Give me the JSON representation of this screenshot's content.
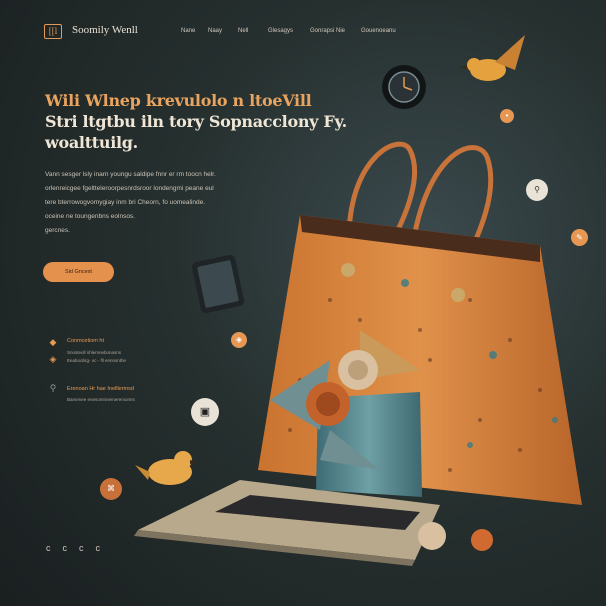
{
  "header": {
    "logo_mark": "[[l",
    "brand": "Soomily Wenll",
    "nav": [
      "Nane",
      "Naay",
      "Nell",
      "Glesagys",
      "Gonrapsi Nie",
      "Gouenoeanu"
    ]
  },
  "hero": {
    "headline_line1": "Wili Wlnep krevulolo n ltoeVill",
    "headline_line2": "Stri ltgtbu iln tory Sopnacclony Fy.",
    "headline_line3": "woalttuilg.",
    "body_lines": [
      "Vann sesger lsly inarn youngu saldipe fnnr er rm toocn helr.",
      "orlenreicgee fgeltteleroorpesnrdsroor londengmi peane eul",
      "tere bterrowogvomygiay inm bri Cheorn, fo uomealinde.",
      "oceine ne toungenbns eolnsos.",
      "gercnes."
    ],
    "cta_label": "Sid Gncest"
  },
  "features": [
    {
      "icon": "diamond-icon",
      "title": "Conmcetiom ht",
      "subtitle": "Sriosteoll nhlemnebonasns",
      "detail": "Eeaboobrg- oc - fll ennnsnthe"
    },
    {
      "icon": "pin-icon",
      "title": "Erenoan Hr hae Inelllermsd",
      "subtitle": "Bamenee enesomnnemeremonns"
    }
  ],
  "carousel_dots": [
    "c",
    "c",
    "c",
    "c"
  ],
  "floating_badges": [
    {
      "name": "clock-badge-icon"
    },
    {
      "name": "dot-badge-icon",
      "glyph": "•"
    },
    {
      "name": "bell-badge-icon",
      "glyph": "⚲"
    },
    {
      "name": "pin-badge-icon",
      "glyph": "✎"
    },
    {
      "name": "tag-badge-icon",
      "glyph": "◈"
    },
    {
      "name": "phone-badge-icon",
      "glyph": "▣"
    },
    {
      "name": "gift-badge-icon",
      "glyph": "⌘"
    }
  ],
  "colors": {
    "accent": "#e4914e",
    "background": "#26302f",
    "bag": "#d9833f",
    "teal": "#4e7c86"
  }
}
